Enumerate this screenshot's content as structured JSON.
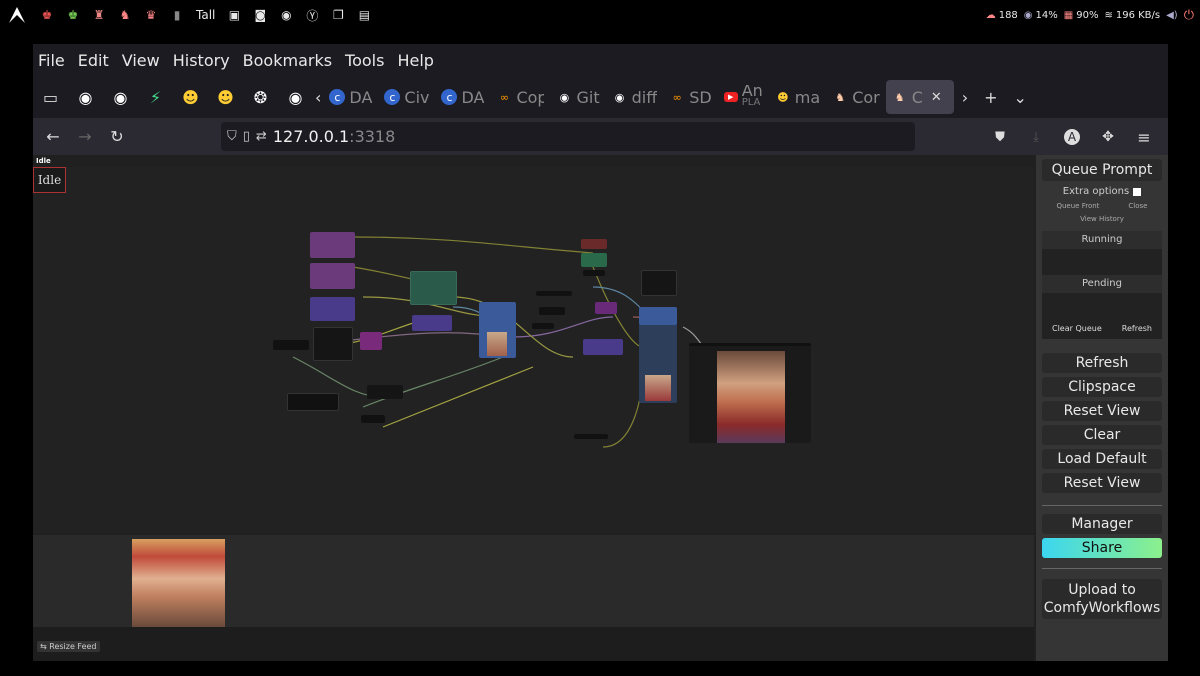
{
  "os_bar": {
    "tall_label": "Tall",
    "stats": {
      "cloud": "188",
      "cpu": "14%",
      "mem": "90%",
      "net": "196 KB/s"
    }
  },
  "browser": {
    "menu": [
      "File",
      "Edit",
      "View",
      "History",
      "Bookmarks",
      "Tools",
      "Help"
    ],
    "tabs": [
      {
        "label": "DA",
        "fav": "C"
      },
      {
        "label": "Civ",
        "fav": "C"
      },
      {
        "label": "DA",
        "fav": "C"
      },
      {
        "label": "Cop",
        "fav": "∞"
      },
      {
        "label": "Git",
        "fav": "gh"
      },
      {
        "label": "diff",
        "fav": "gh"
      },
      {
        "label": "SD",
        "fav": "∞"
      },
      {
        "label": "An",
        "sub": "PLA",
        "fav": "yt"
      },
      {
        "label": "ma",
        "fav": "hf"
      },
      {
        "label": "Cor",
        "fav": "fox"
      },
      {
        "label": "C",
        "fav": "fox"
      }
    ],
    "url": {
      "host": "127.0.0.1",
      "port": ":3318"
    }
  },
  "page": {
    "status_small": "Idle",
    "status_box": "Idle",
    "resize_feed": "Resize Feed"
  },
  "side_menu": {
    "queue_prompt": "Queue Prompt",
    "extra_options": "Extra options",
    "queue_front": "Queue Front",
    "close": "Close",
    "view_history": "View History",
    "running": "Running",
    "pending": "Pending",
    "clear_queue": "Clear Queue",
    "refresh_small": "Refresh",
    "buttons": [
      "Refresh",
      "Clipspace",
      "Reset View",
      "Clear",
      "Load Default",
      "Reset View"
    ],
    "manager": "Manager",
    "share": "Share",
    "upload": "Upload to ComfyWorkflows"
  },
  "colors": {
    "accent_share_start": "#3bd6f0",
    "accent_share_end": "#8cf08c",
    "idle_border": "#aa3333"
  }
}
